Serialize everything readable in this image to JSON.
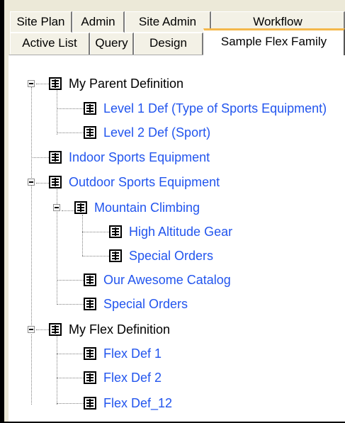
{
  "colors": {
    "link_text": "#2255ee",
    "plain_text": "#000000",
    "active_tab_accent": "#f4b84c",
    "tab_face": "#f3f1e6",
    "window_bg": "#ece9d8"
  },
  "tabs": {
    "back_row": [
      "Site Plan",
      "Admin",
      "Site Admin",
      "Workflow"
    ],
    "front_row": [
      "Active List",
      "Query",
      "Design"
    ],
    "active": "Sample Flex Family"
  },
  "tree": [
    {
      "label": "My Parent Definition",
      "style": "plain",
      "icon": "form-icon",
      "expanded": true
    },
    {
      "label": "Level 1 Def (Type of Sports Equipment)",
      "style": "link",
      "icon": "form-icon"
    },
    {
      "label": "Level 2 Def (Sport)",
      "style": "link",
      "icon": "form-icon"
    },
    {
      "label": "Indoor Sports Equipment",
      "style": "link",
      "icon": "form-icon"
    },
    {
      "label": "Outdoor Sports Equipment",
      "style": "link",
      "icon": "form-icon",
      "expanded": true
    },
    {
      "label": "Mountain Climbing",
      "style": "link",
      "icon": "form-icon",
      "expanded": true
    },
    {
      "label": "High Altitude Gear",
      "style": "link",
      "icon": "form-icon"
    },
    {
      "label": "Special Orders",
      "style": "link",
      "icon": "form-icon"
    },
    {
      "label": "Our Awesome Catalog",
      "style": "link",
      "icon": "form-icon"
    },
    {
      "label": "Special Orders",
      "style": "link",
      "icon": "form-icon"
    },
    {
      "label": "My Flex Definition",
      "style": "plain",
      "icon": "form-icon",
      "expanded": true
    },
    {
      "label": "Flex Def 1",
      "style": "link",
      "icon": "form-icon"
    },
    {
      "label": "Flex Def 2",
      "style": "link",
      "icon": "form-icon"
    },
    {
      "label": "Flex Def_12",
      "style": "link",
      "icon": "form-icon"
    }
  ]
}
